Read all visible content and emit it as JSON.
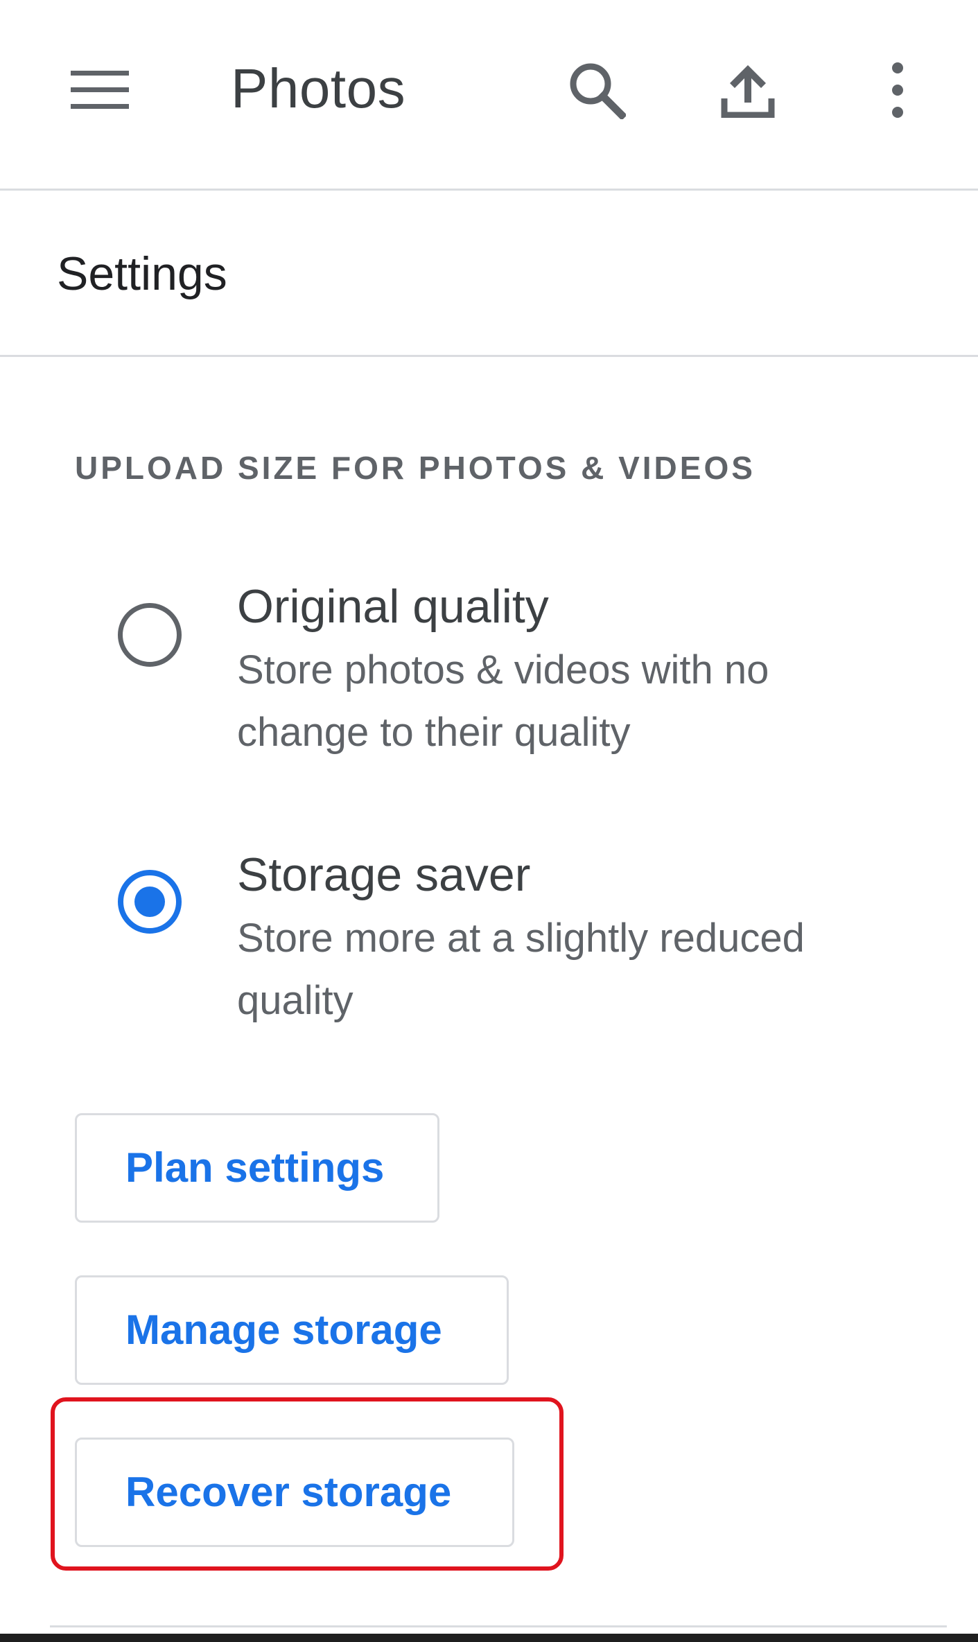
{
  "app_bar": {
    "title": "Photos",
    "icons": {
      "menu": "menu-icon",
      "search": "search-icon",
      "upload": "upload-icon",
      "more": "more-vert-icon"
    }
  },
  "settings": {
    "title": "Settings"
  },
  "upload_size": {
    "header": "UPLOAD SIZE FOR PHOTOS & VIDEOS",
    "options": [
      {
        "label": "Original quality",
        "description_line1": "Store photos & videos with no",
        "description_line2": "change to their quality",
        "selected": false
      },
      {
        "label": "Storage saver",
        "description_line1": "Store more at a slightly reduced",
        "description_line2": "quality",
        "selected": true
      }
    ]
  },
  "buttons": {
    "plan_settings": "Plan settings",
    "manage_storage": "Manage storage",
    "recover_storage": "Recover storage"
  },
  "colors": {
    "accent": "#1a73e8",
    "highlight": "#e0141e",
    "text_primary": "#202124",
    "text_secondary": "#5f6368",
    "divider": "#dadce0"
  }
}
